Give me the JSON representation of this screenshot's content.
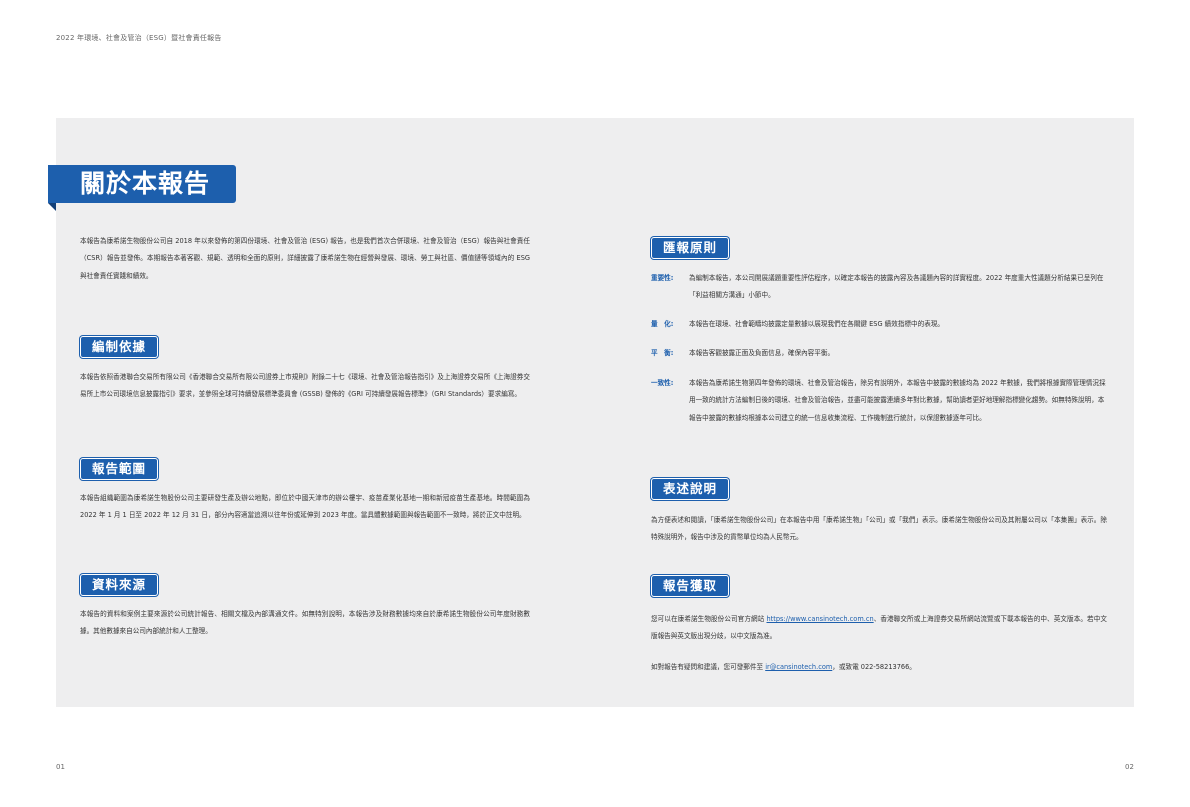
{
  "header": {
    "title": "2022 年環境、社會及管治（ESG）暨社會責任報告"
  },
  "page_numbers": {
    "left": "01",
    "right": "02"
  },
  "main_title": "關於本報告",
  "intro": "本報告為康希諾生物股份公司自 2018 年以來發佈的第四份環境、社會及管治 (ESG) 報告，也是我們首次合併環境、社會及管治（ESG）報告與社會責任（CSR）報告並發佈。本期報告本著客觀、規範、透明和全面的原則，詳細披露了康希諾生物在經營與發展、環境、勞工與社區、價值鏈等領域內的 ESG 與社會責任實踐和績效。",
  "sections": {
    "basis": {
      "title": "編制依據",
      "text": "本報告依照香港聯合交易所有限公司《香港聯合交易所有限公司證券上市規則》附錄二十七《環境、社會及管治報告指引》及上海證券交易所《上海證券交易所上市公司環境信息披露指引》要求，並參照全球可持續發展標準委員會 (GSSB) 發佈的《GRI 可持續發展報告標準》（GRI Standards）要求編寫。"
    },
    "scope": {
      "title": "報告範圍",
      "text": "本報告組織範圍為康希諾生物股份公司主要研發生產及辦公地點，即位於中國天津市的辦公樓宇、疫苗產業化基地一期和新冠疫苗生產基地。時間範圍為 2022 年 1 月 1 日至 2022 年 12 月 31 日，部分內容適當追溯以往年份或延伸到 2023 年度。當具體數據範圍與報告範圍不一致時，將於正文中註明。"
    },
    "sources": {
      "title": "資料來源",
      "text": "本報告的資料和案例主要來源於公司統計報告、相關文檔及內部溝通文件。如無特別說明，本報告涉及財務數據均來自於康希諾生物股份公司年度財務數據。其他數據來自公司內部統計和人工整理。"
    },
    "principles": {
      "title": "匯報原則",
      "items": [
        {
          "term": "重要性:",
          "text": "為編制本報告，本公司開展議題重要性評估程序，以確定本報告的披露內容及各議題內容的詳實程度。2022 年度重大性議題分析結果已呈列在「利益相關方溝通」小節中。"
        },
        {
          "term": "量　化:",
          "text": "本報告在環境、社會範疇均披露定量數據以展現我們在各關鍵 ESG 績效指標中的表現。"
        },
        {
          "term": "平　衡:",
          "text": "本報告客觀披露正面及負面信息，確保內容平衡。"
        },
        {
          "term": "一致性:",
          "text": "本報告為康希諾生物第四年發佈的環境、社會及管治報告，除另有說明外，本報告中披露的數據均為 2022 年數據，我們將根據實際管理情況採用一致的統計方法編制日後的環境、社會及管治報告，並盡可能披露連續多年對比數據，幫助讀者更好地理解指標變化趨勢。如無特殊說明，本報告中披露的數據均根據本公司建立的統一信息收集流程、工作機制進行統計，以保證數據逐年可比。"
        }
      ]
    },
    "expression": {
      "title": "表述說明",
      "text": "為方便表述和閱讀，「康希諾生物股份公司」在本報告中用「康希諾生物」「公司」或「我們」表示。康希諾生物股份公司及其附屬公司以「本集團」表示。除特殊說明外，報告中涉及的貨幣單位均為人民幣元。"
    },
    "access": {
      "title": "報告獲取",
      "text1_before": "您可以在康希諾生物股份公司官方網站 ",
      "url": "https://www.cansinotech.com.cn",
      "text1_after": "、香港聯交所或上海證券交易所網站流覽或下載本報告的中、英文版本。若中文版報告與英文版出現分歧，以中文版為准。",
      "text2_before": "如對報告有疑問和建議，您可發郵件至 ",
      "email": "ir@cansinotech.com",
      "text2_after": "，或致電 022-58213766。"
    }
  },
  "colors": {
    "accent": "#1d5fad",
    "panel": "#eeeeef"
  }
}
